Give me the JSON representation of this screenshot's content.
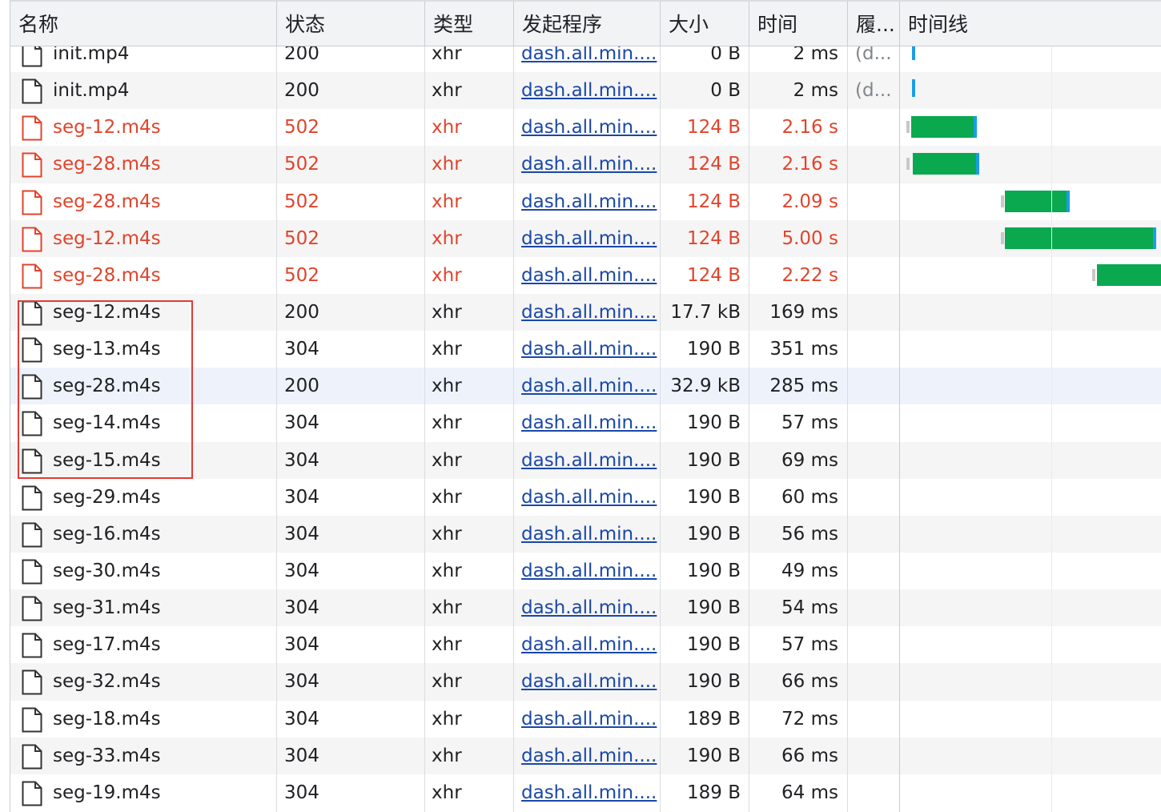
{
  "columns": {
    "name": "名称",
    "status": "状态",
    "type": "类型",
    "initiator": "发起程序",
    "size": "大小",
    "time": "时间",
    "waterfall": "履...",
    "timeline": "时间线"
  },
  "colors": {
    "error": "#e0442c",
    "link": "#1a48a8",
    "bar_green": "#0aa84f",
    "bar_blue": "#1a9de8",
    "highlight_box": "#e53935"
  },
  "rows": [
    {
      "name": "init.mp4",
      "status": "200",
      "type": "xhr",
      "initiator": "dash.all.min....",
      "size": "0 B",
      "time": "2 ms",
      "extra": "(d...",
      "error": false
    },
    {
      "name": "init.mp4",
      "status": "200",
      "type": "xhr",
      "initiator": "dash.all.min....",
      "size": "0 B",
      "time": "2 ms",
      "extra": "(d...",
      "error": false
    },
    {
      "name": "seg-12.m4s",
      "status": "502",
      "type": "xhr",
      "initiator": "dash.all.min....",
      "size": "124 B",
      "time": "2.16 s",
      "extra": "",
      "error": true
    },
    {
      "name": "seg-28.m4s",
      "status": "502",
      "type": "xhr",
      "initiator": "dash.all.min....",
      "size": "124 B",
      "time": "2.16 s",
      "extra": "",
      "error": true
    },
    {
      "name": "seg-28.m4s",
      "status": "502",
      "type": "xhr",
      "initiator": "dash.all.min....",
      "size": "124 B",
      "time": "2.09 s",
      "extra": "",
      "error": true
    },
    {
      "name": "seg-12.m4s",
      "status": "502",
      "type": "xhr",
      "initiator": "dash.all.min....",
      "size": "124 B",
      "time": "5.00 s",
      "extra": "",
      "error": true
    },
    {
      "name": "seg-28.m4s",
      "status": "502",
      "type": "xhr",
      "initiator": "dash.all.min....",
      "size": "124 B",
      "time": "2.22 s",
      "extra": "",
      "error": true
    },
    {
      "name": "seg-12.m4s",
      "status": "200",
      "type": "xhr",
      "initiator": "dash.all.min....",
      "size": "17.7 kB",
      "time": "169 ms",
      "extra": "",
      "error": false
    },
    {
      "name": "seg-13.m4s",
      "status": "304",
      "type": "xhr",
      "initiator": "dash.all.min....",
      "size": "190 B",
      "time": "351 ms",
      "extra": "",
      "error": false
    },
    {
      "name": "seg-28.m4s",
      "status": "200",
      "type": "xhr",
      "initiator": "dash.all.min....",
      "size": "32.9 kB",
      "time": "285 ms",
      "extra": "",
      "error": false
    },
    {
      "name": "seg-14.m4s",
      "status": "304",
      "type": "xhr",
      "initiator": "dash.all.min....",
      "size": "190 B",
      "time": "57 ms",
      "extra": "",
      "error": false
    },
    {
      "name": "seg-15.m4s",
      "status": "304",
      "type": "xhr",
      "initiator": "dash.all.min....",
      "size": "190 B",
      "time": "69 ms",
      "extra": "",
      "error": false
    },
    {
      "name": "seg-29.m4s",
      "status": "304",
      "type": "xhr",
      "initiator": "dash.all.min....",
      "size": "190 B",
      "time": "60 ms",
      "extra": "",
      "error": false
    },
    {
      "name": "seg-16.m4s",
      "status": "304",
      "type": "xhr",
      "initiator": "dash.all.min....",
      "size": "190 B",
      "time": "56 ms",
      "extra": "",
      "error": false
    },
    {
      "name": "seg-30.m4s",
      "status": "304",
      "type": "xhr",
      "initiator": "dash.all.min....",
      "size": "190 B",
      "time": "49 ms",
      "extra": "",
      "error": false
    },
    {
      "name": "seg-31.m4s",
      "status": "304",
      "type": "xhr",
      "initiator": "dash.all.min....",
      "size": "190 B",
      "time": "54 ms",
      "extra": "",
      "error": false
    },
    {
      "name": "seg-17.m4s",
      "status": "304",
      "type": "xhr",
      "initiator": "dash.all.min....",
      "size": "190 B",
      "time": "57 ms",
      "extra": "",
      "error": false
    },
    {
      "name": "seg-32.m4s",
      "status": "304",
      "type": "xhr",
      "initiator": "dash.all.min....",
      "size": "190 B",
      "time": "66 ms",
      "extra": "",
      "error": false
    },
    {
      "name": "seg-18.m4s",
      "status": "304",
      "type": "xhr",
      "initiator": "dash.all.min....",
      "size": "189 B",
      "time": "72 ms",
      "extra": "",
      "error": false
    },
    {
      "name": "seg-33.m4s",
      "status": "304",
      "type": "xhr",
      "initiator": "dash.all.min....",
      "size": "190 B",
      "time": "66 ms",
      "extra": "",
      "error": false
    },
    {
      "name": "seg-19.m4s",
      "status": "304",
      "type": "xhr",
      "initiator": "dash.all.min....",
      "size": "189 B",
      "time": "64 ms",
      "extra": "",
      "error": false
    }
  ]
}
